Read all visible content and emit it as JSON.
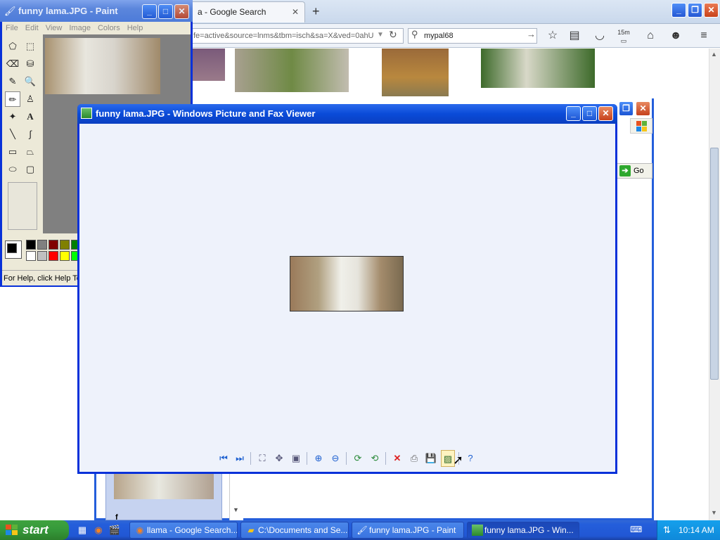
{
  "firefox": {
    "tab_title": "llama - Google Search",
    "tab_title_visible": "a - Google Search",
    "url": "fe=active&source=lnms&tbm=isch&sa=X&ved=0ahU",
    "search_value": "mypal68",
    "timer_badge": "15m"
  },
  "background_window": {
    "go_label": "Go",
    "thumb_caption": "f"
  },
  "paint": {
    "title": "funny lama.JPG - Paint",
    "menu": [
      "File",
      "Edit",
      "View",
      "Image",
      "Colors",
      "Help"
    ],
    "status": "For Help, click Help Topics on the Help Menu."
  },
  "viewer": {
    "title": "funny lama.JPG - Windows Picture and Fax Viewer"
  },
  "taskbar": {
    "start_label": "start",
    "buttons": [
      {
        "label": "llama - Google Search..."
      },
      {
        "label": "C:\\Documents and Se..."
      },
      {
        "label": "funny lama.JPG - Paint"
      },
      {
        "label": "funny lama.JPG - Win..."
      }
    ],
    "clock": "10:14 AM"
  },
  "colors": {
    "xp_blue": "#0831d9",
    "start_green": "#35983a",
    "viewer_bg": "#eef2fb"
  }
}
